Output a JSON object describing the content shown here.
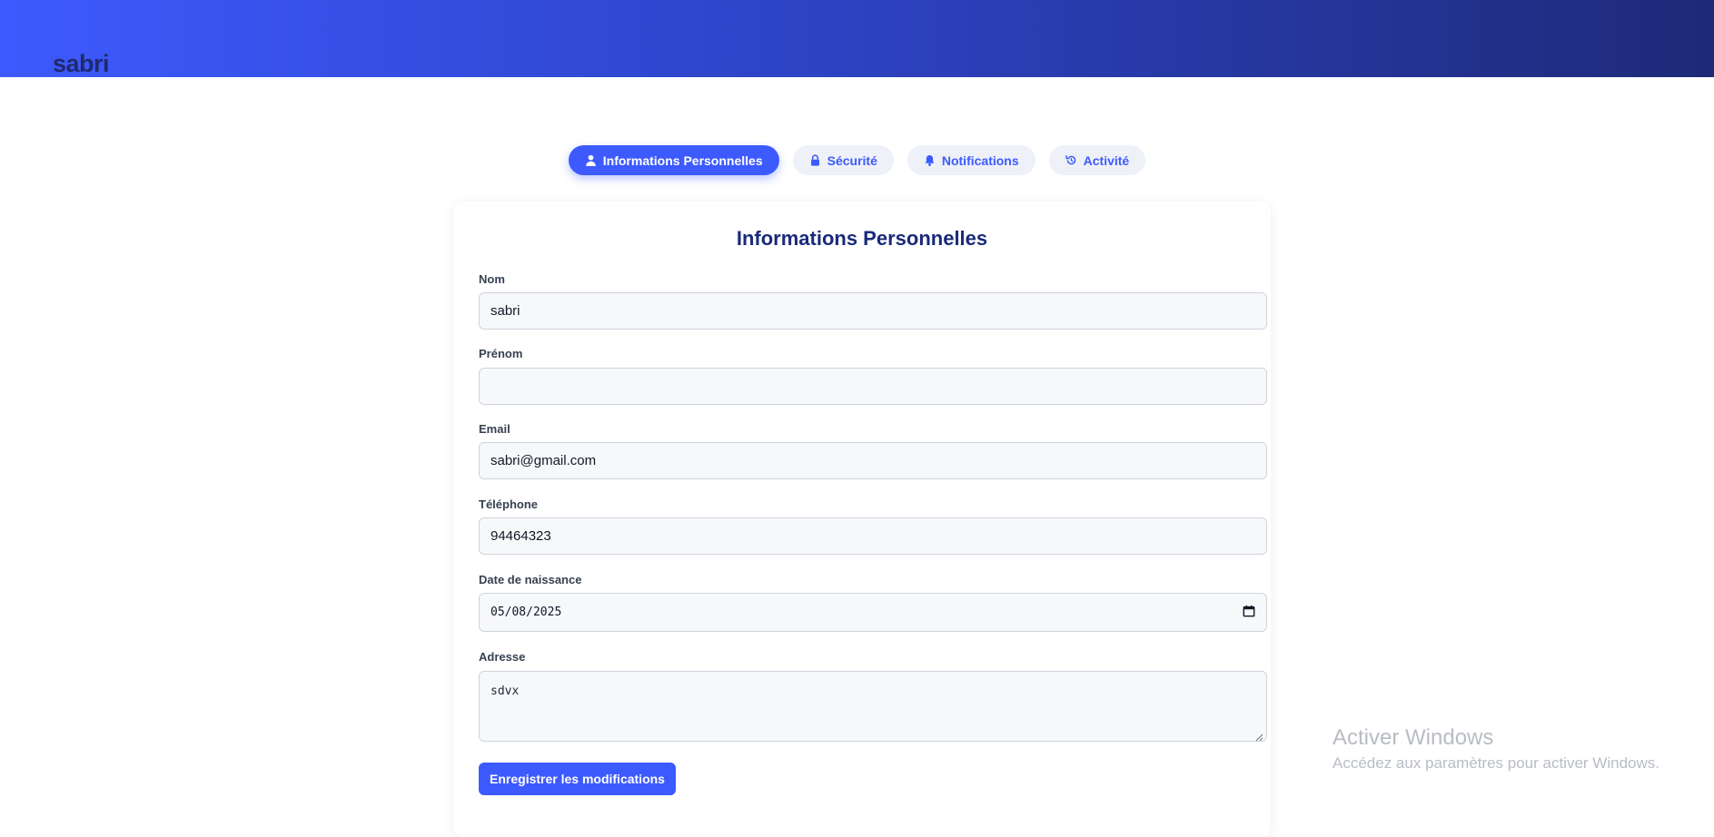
{
  "header": {
    "title": "sabri",
    "gradient": [
      "#3d5afe",
      "#1e2a78"
    ]
  },
  "tabs": [
    {
      "label": "Informations Personnelles",
      "icon": "user-icon",
      "active": true
    },
    {
      "label": "Sécurité",
      "icon": "lock-icon",
      "active": false
    },
    {
      "label": "Notifications",
      "icon": "bell-icon",
      "active": false
    },
    {
      "label": "Activité",
      "icon": "history-icon",
      "active": false
    }
  ],
  "form": {
    "title": "Informations Personnelles",
    "fields": {
      "nom": {
        "label": "Nom",
        "value": "sabri"
      },
      "prenom": {
        "label": "Prénom",
        "value": ""
      },
      "email": {
        "label": "Email",
        "value": "sabri@gmail.com"
      },
      "telephone": {
        "label": "Téléphone",
        "value": "94464323"
      },
      "date_naissance": {
        "label": "Date de naissance",
        "value": "05/08/2025"
      },
      "adresse": {
        "label": "Adresse",
        "value": "sdvx"
      }
    },
    "save_label": "Enregistrer les modifications"
  },
  "watermark": {
    "title": "Activer Windows",
    "subtitle": "Accédez aux paramètres pour activer Windows."
  },
  "colors": {
    "accent": "#3d5afe",
    "title": "#1a2a7a",
    "input_bg": "#f7f8fa"
  }
}
